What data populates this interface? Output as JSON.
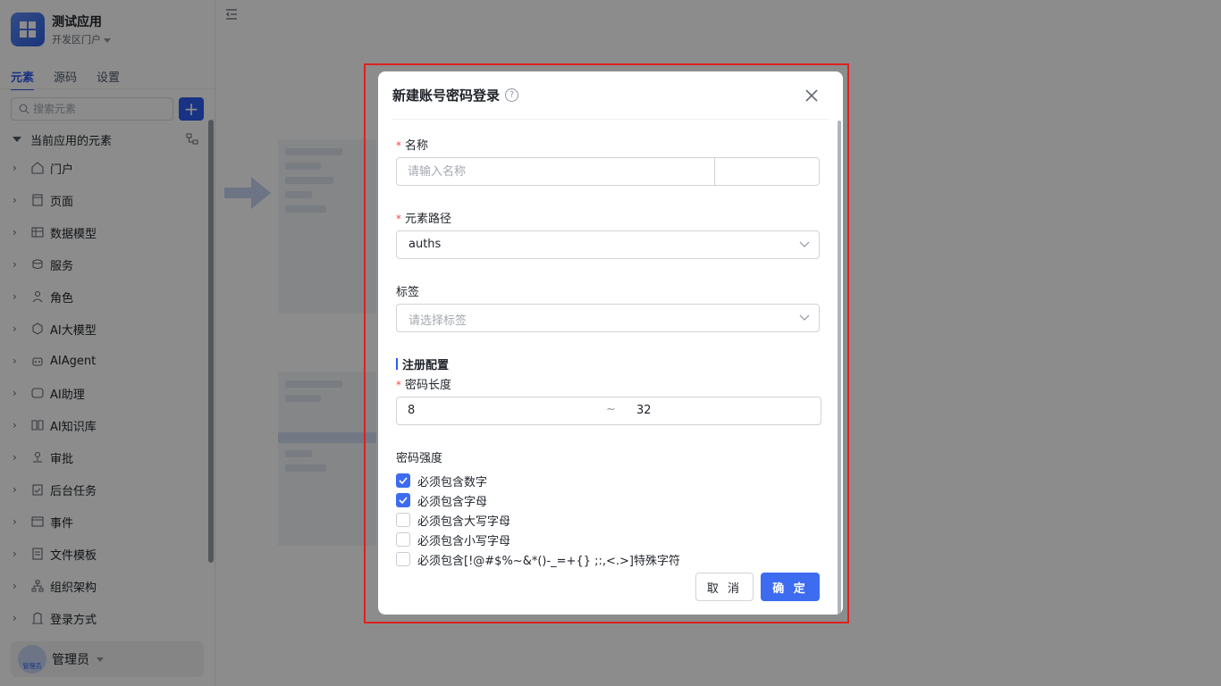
{
  "app": {
    "name": "测试应用",
    "portal": "开发区门户"
  },
  "tabs": [
    "元素",
    "源码",
    "设置"
  ],
  "search": {
    "placeholder": "搜索元素",
    "add_label": "+"
  },
  "tree": {
    "header": "当前应用的元素",
    "items": [
      {
        "label": "门户",
        "icon": "home-icon"
      },
      {
        "label": "页面",
        "icon": "page-icon"
      },
      {
        "label": "数据模型",
        "icon": "table-icon"
      },
      {
        "label": "服务",
        "icon": "service-icon"
      },
      {
        "label": "角色",
        "icon": "role-icon"
      },
      {
        "label": "AI大模型",
        "icon": "ai-model-icon"
      },
      {
        "label": "AIAgent",
        "icon": "robot-icon"
      },
      {
        "label": "AI助理",
        "icon": "ai-assistant-icon"
      },
      {
        "label": "AI知识库",
        "icon": "knowledge-icon"
      },
      {
        "label": "审批",
        "icon": "approval-icon"
      },
      {
        "label": "后台任务",
        "icon": "task-icon"
      },
      {
        "label": "事件",
        "icon": "event-icon"
      },
      {
        "label": "文件模板",
        "icon": "file-template-icon"
      },
      {
        "label": "组织架构",
        "icon": "org-icon"
      },
      {
        "label": "登录方式",
        "icon": "login-icon"
      }
    ]
  },
  "user": {
    "name": "管理员",
    "avatar_text": "管理员"
  },
  "modal": {
    "title": "新建账号密码登录",
    "name_label": "名称",
    "name_placeholder": "请输入名称",
    "path_label": "元素路径",
    "path_value": "auths",
    "tag_label": "标签",
    "tag_placeholder": "请选择标签",
    "section_title": "注册配置",
    "pwd_len_label": "密码长度",
    "pwd_min": "8",
    "pwd_sep": "~",
    "pwd_max": "32",
    "strength_label": "密码强度",
    "checks": [
      {
        "label": "必须包含数字",
        "checked": true
      },
      {
        "label": "必须包含字母",
        "checked": true
      },
      {
        "label": "必须包含大写字母",
        "checked": false
      },
      {
        "label": "必须包含小写字母",
        "checked": false
      },
      {
        "label": "必须包含[!@#$%~&*()-_=+{} ;:,<.>]特殊字符",
        "checked": false
      }
    ],
    "cancel_label": "取 消",
    "ok_label": "确 定"
  },
  "colors": {
    "primary": "#2c5bf0",
    "required": "#f54a45",
    "highlight": "#e02020"
  }
}
